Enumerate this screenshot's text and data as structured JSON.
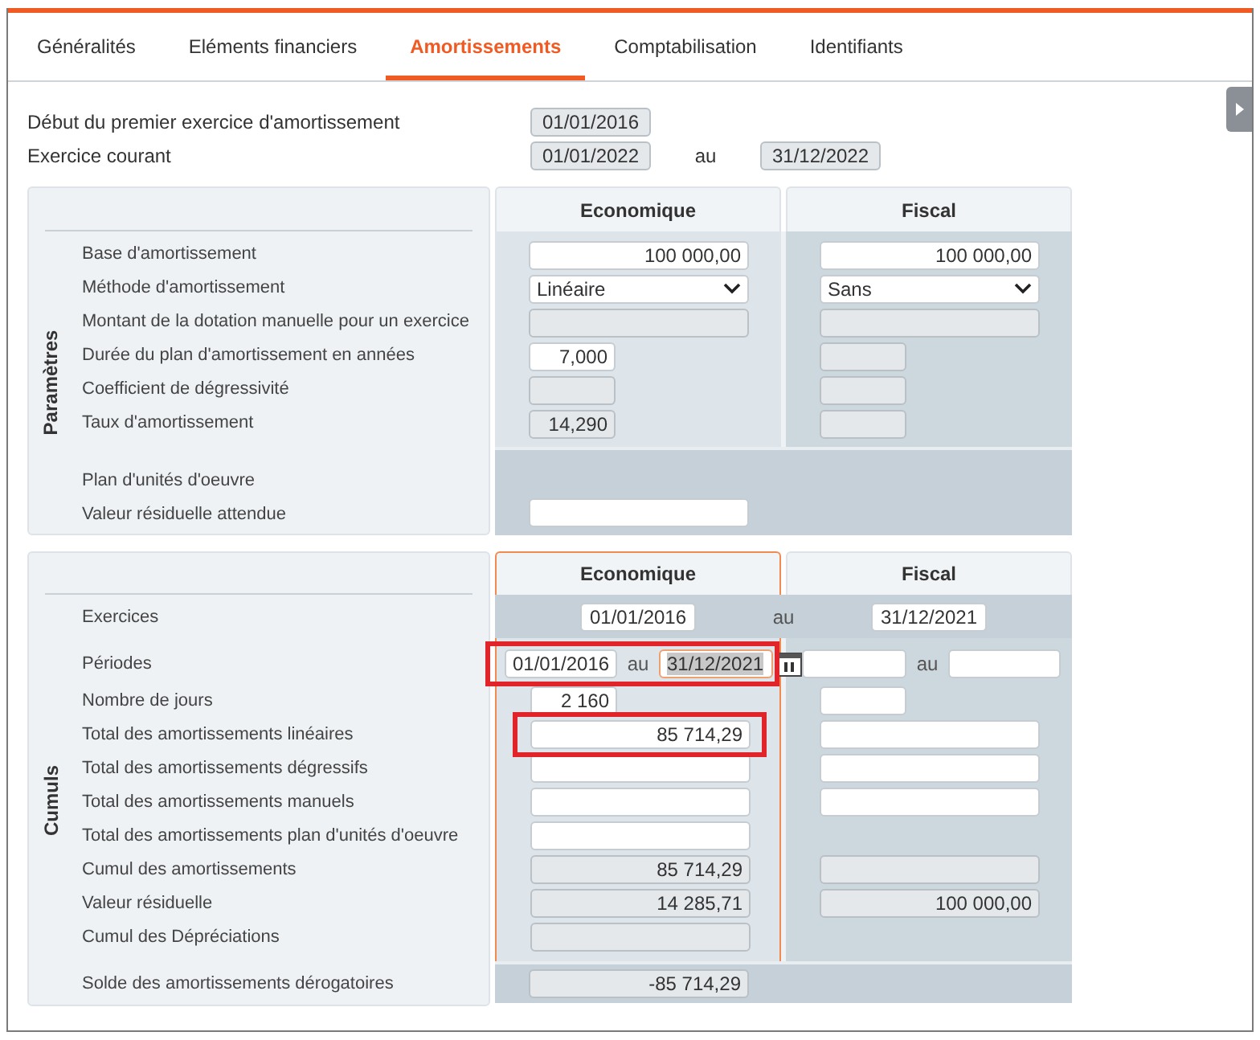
{
  "tabs": [
    {
      "label": "Généralités",
      "selected": false
    },
    {
      "label": "Eléments financiers",
      "selected": false
    },
    {
      "label": "Amortissements",
      "selected": true
    },
    {
      "label": "Comptabilisation",
      "selected": false
    },
    {
      "label": "Identifiants",
      "selected": false
    }
  ],
  "header_fields": [
    {
      "label": "Début du premier exercice d'amortissement",
      "value": "01/01/2016"
    },
    {
      "label": "Exercice courant",
      "value": "01/01/2022",
      "connector": "au",
      "value_end": "31/12/2022"
    }
  ],
  "parametres": {
    "title": "Paramètres",
    "columns": [
      {
        "label": "Economique",
        "selected": false
      },
      {
        "label": "Fiscal",
        "selected": false
      }
    ],
    "rows": [
      {
        "label": "Base d'amortissement",
        "economique": {
          "kind": "amount",
          "value": "100 000,00",
          "editable": true
        },
        "fiscal": {
          "kind": "amount",
          "value": "100 000,00",
          "editable": true
        }
      },
      {
        "label": "Méthode d'amortissement",
        "economique": {
          "kind": "select",
          "value": "Linéaire",
          "editable": true
        },
        "fiscal": {
          "kind": "select",
          "value": "Sans",
          "editable": true
        }
      },
      {
        "label": "Montant de la dotation manuelle pour un exercice",
        "economique": {
          "kind": "amount",
          "editable": false
        },
        "fiscal": {
          "kind": "amount",
          "editable": false
        }
      },
      {
        "label": "Durée du plan d'amortissement en années",
        "economique": {
          "kind": "number",
          "value": "7,000",
          "editable": true
        },
        "fiscal": {
          "kind": "number",
          "editable": false
        }
      },
      {
        "label": "Coefficient de dégressivité",
        "economique": {
          "kind": "number",
          "editable": false
        },
        "fiscal": {
          "kind": "number",
          "editable": false
        }
      },
      {
        "label": "Taux d'amortissement",
        "economique": {
          "kind": "number",
          "value": "14,290",
          "editable": false
        },
        "fiscal": {
          "kind": "number",
          "editable": false
        }
      }
    ],
    "band_rows": [
      {
        "label": "Plan d'unités d'oeuvre"
      },
      {
        "label": "Valeur résiduelle attendue",
        "economique": {
          "kind": "amount",
          "editable": true
        }
      }
    ]
  },
  "cumuls": {
    "title": "Cumuls",
    "columns": [
      {
        "label": "Economique",
        "selected": true
      },
      {
        "label": "Fiscal",
        "selected": false
      }
    ],
    "exercices": {
      "label": "Exercices",
      "start": "01/01/2016",
      "connector": "au",
      "end": "31/12/2021"
    },
    "periodes": {
      "label": "Périodes",
      "economique": {
        "start": "01/01/2016",
        "connector": "au",
        "end": "31/12/2021",
        "end_focused": true,
        "highlighted": true
      },
      "fiscal": {
        "connector": "au"
      }
    },
    "rows": [
      {
        "label": "Nombre de jours",
        "economique": {
          "kind": "number",
          "value": "2 160",
          "editable": true
        },
        "fiscal": {
          "kind": "number",
          "editable": true
        }
      },
      {
        "label": "Total des amortissements linéaires",
        "economique": {
          "kind": "amount",
          "value": "85 714,29",
          "editable": true,
          "highlighted": true
        },
        "fiscal": {
          "kind": "amount",
          "editable": true
        }
      },
      {
        "label": "Total des amortissements dégressifs",
        "economique": {
          "kind": "amount",
          "editable": true
        },
        "fiscal": {
          "kind": "amount",
          "editable": true
        }
      },
      {
        "label": "Total des amortissements manuels",
        "economique": {
          "kind": "amount",
          "editable": true
        },
        "fiscal": {
          "kind": "amount",
          "editable": true
        }
      },
      {
        "label": "Total des amortissements plan d'unités d'oeuvre",
        "economique": {
          "kind": "amount",
          "editable": true
        }
      },
      {
        "label": "Cumul des amortissements",
        "economique": {
          "kind": "amount",
          "value": "85 714,29",
          "editable": false
        },
        "fiscal": {
          "kind": "amount",
          "editable": false
        }
      },
      {
        "label": "Valeur résiduelle",
        "economique": {
          "kind": "amount",
          "value": "14 285,71",
          "editable": false
        },
        "fiscal": {
          "kind": "amount",
          "value": "100 000,00",
          "editable": false
        }
      },
      {
        "label": "Cumul des Dépréciations",
        "economique": {
          "kind": "amount",
          "editable": false
        }
      }
    ],
    "footer_rows": [
      {
        "label": "Solde des amortissements dérogatoires",
        "economique": {
          "kind": "amount",
          "value": "-85 714,29",
          "editable": false
        }
      }
    ]
  }
}
